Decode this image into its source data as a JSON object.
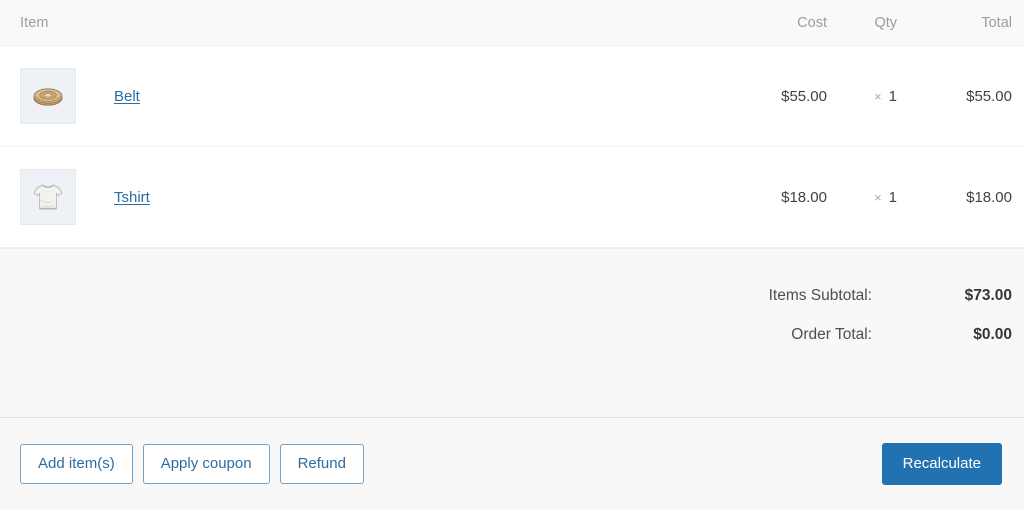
{
  "colors": {
    "primary_button": "#2271b1",
    "link": "#2d6ca2",
    "header_text": "#989ea3",
    "body_text": "#3c434a",
    "totals_background": "#f8f8f8",
    "thumb_background": "#eef2f6"
  },
  "table": {
    "headers": {
      "item": "Item",
      "cost": "Cost",
      "qty": "Qty",
      "total": "Total"
    },
    "rows": [
      {
        "name": "Belt",
        "thumbnail": "belt-thumbnail",
        "cost": "$55.00",
        "qty_symbol": "×",
        "qty": "1",
        "total": "$55.00"
      },
      {
        "name": "Tshirt",
        "thumbnail": "tshirt-thumbnail",
        "cost": "$18.00",
        "qty_symbol": "×",
        "qty": "1",
        "total": "$18.00"
      }
    ]
  },
  "totals": [
    {
      "label": "Items Subtotal:",
      "value": "$73.00"
    },
    {
      "label": "Order Total:",
      "value": "$0.00"
    }
  ],
  "footer": {
    "add_items_label": "Add item(s)",
    "apply_coupon_label": "Apply coupon",
    "refund_label": "Refund",
    "recalculate_label": "Recalculate"
  }
}
